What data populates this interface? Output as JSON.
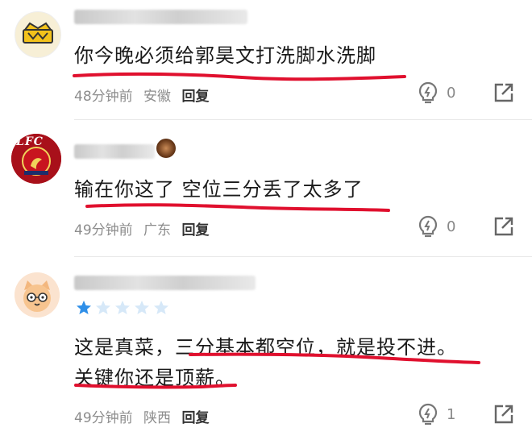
{
  "comments": [
    {
      "text": "你今晚必须给郭昊文打洗脚水洗脚",
      "time": "48分钟前",
      "location": "安徽",
      "reply_label": "回复",
      "likes": "0"
    },
    {
      "text": "输在你这了 空位三分丢了太多了",
      "avatar_badge": "LFC",
      "time": "49分钟前",
      "location": "广东",
      "reply_label": "回复",
      "likes": "0"
    },
    {
      "text_line1": "这是真菜，三分基本都空位，就是投不进。",
      "text_line2": "关键你还是顶薪。",
      "time": "49分钟前",
      "location": "陕西",
      "reply_label": "回复",
      "likes": "1",
      "rating": 1,
      "rating_max": 5
    }
  ],
  "colors": {
    "underline": "#e0102e",
    "meta": "#8d8d8d",
    "star_active": "#2f8fe8",
    "star_inactive": "#d6e8f8",
    "icon": "#777777"
  }
}
